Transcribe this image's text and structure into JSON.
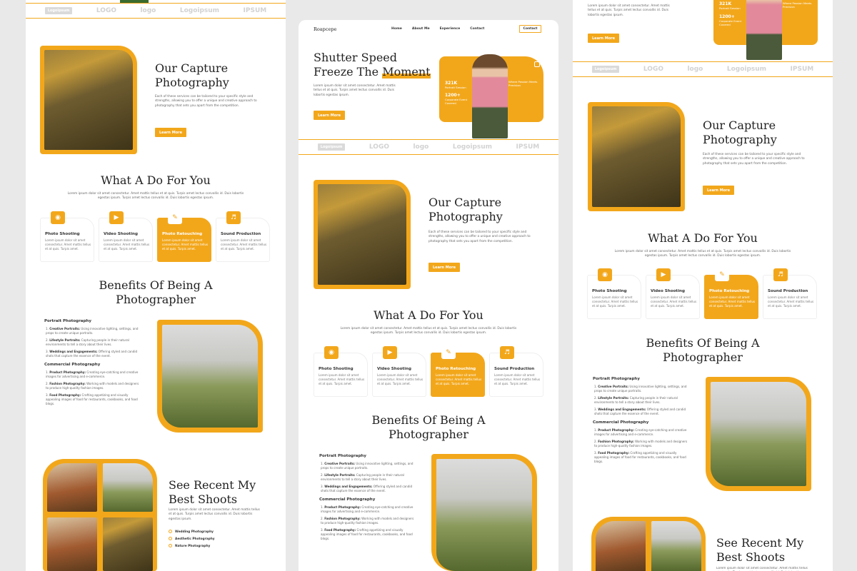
{
  "brand": "Roapcepe",
  "nav": [
    "Home",
    "About Me",
    "Experience",
    "Contact"
  ],
  "nav_button": "Contact",
  "hero": {
    "title_line1": "Shutter Speed",
    "title_line2_a": "Freeze The ",
    "title_line2_b": "Moment",
    "text": "Lorem ipsum dolor sit amet consectetur. Amet mattis tellus et at quis. Turpis amet lectus convallis id. Duis lobortis egestas ipsum.",
    "button": "Learn More",
    "stat1_value": "321K",
    "stat1_label": "Portrait Session",
    "stat2_value": "1200+",
    "stat2_label": "Corporate Event Covered",
    "badge": "Where Passion Meets Precision"
  },
  "logos": [
    "Logoipsum",
    "LOGO",
    "logo",
    "Logoipsum",
    "IPSUM"
  ],
  "capture": {
    "title_line1": "Our Capture",
    "title_line2": "Photography",
    "text": "Each of these services can be tailored to your specific style and strengths, allowing you to offer a unique and creative approach to photography that sets you apart from the competition.",
    "button": "Learn More"
  },
  "services": {
    "title": "What A Do For You",
    "text": "Lorem ipsum dolor sit amet consectetur. Amet mattis tellus et at quis. Turpis amet lectus convallis id. Duis lobortis egestas ipsum. Turpis amet lectus convallis id. Duis lobortis egestas ipsum.",
    "items": [
      {
        "title": "Photo Shooting",
        "desc": "Lorem ipsum dolor sit amet consectetur. Amet mattis tellus et at quis. Turpis amet.",
        "icon": "camera-icon"
      },
      {
        "title": "Video Shooting",
        "desc": "Lorem ipsum dolor sit amet consectetur. Amet mattis tellus et at quis. Turpis amet.",
        "icon": "video-icon"
      },
      {
        "title": "Photo Retouching",
        "desc": "Lorem ipsum dolor sit amet consectetur. Amet mattis tellus et at quis. Turpis amet.",
        "icon": "retouch-icon"
      },
      {
        "title": "Sound Production",
        "desc": "Lorem ipsum dolor sit amet consectetur. Amet mattis tellus et at quis. Turpis amet.",
        "icon": "sound-icon"
      }
    ]
  },
  "benefits": {
    "title_line1": "Benefits Of Being A",
    "title_line2": "Photographer",
    "portrait_head": "Portrait Photography",
    "portrait": [
      {
        "b": "Creative Portraits:",
        "t": "Using innovative lighting, settings, and props to create unique portraits."
      },
      {
        "b": "Lifestyle Portraits:",
        "t": "Capturing people in their natural environments to tell a story about their lives."
      },
      {
        "b": "Weddings and Engagements:",
        "t": "Offering styled and candid shots that capture the essence of the event."
      }
    ],
    "commercial_head": "Commercial Photography",
    "commercial": [
      {
        "b": "Product Photography:",
        "t": "Creating eye-catching and creative images for advertising and e-commerce."
      },
      {
        "b": "Fashion Photography:",
        "t": "Working with models and designers to produce high-quality fashion images."
      },
      {
        "b": "Food Photography:",
        "t": "Crafting appetizing and visually appealing images of food for restaurants, cookbooks, and food blogs."
      }
    ]
  },
  "recent": {
    "title_line1": "See Recent My",
    "title_line2": "Best Shoots",
    "text": "Lorem ipsum dolor sit amet consectetur. Amet mattis tellus et at quis. Turpis amet lectus convallis id. Duis lobortis egestas ipsum.",
    "list": [
      "Wedding Photography",
      "Aesthetic Photography",
      "Nature Photography"
    ]
  },
  "colors": {
    "accent": "#f2a71b",
    "text": "#222222",
    "muted": "#666666"
  }
}
